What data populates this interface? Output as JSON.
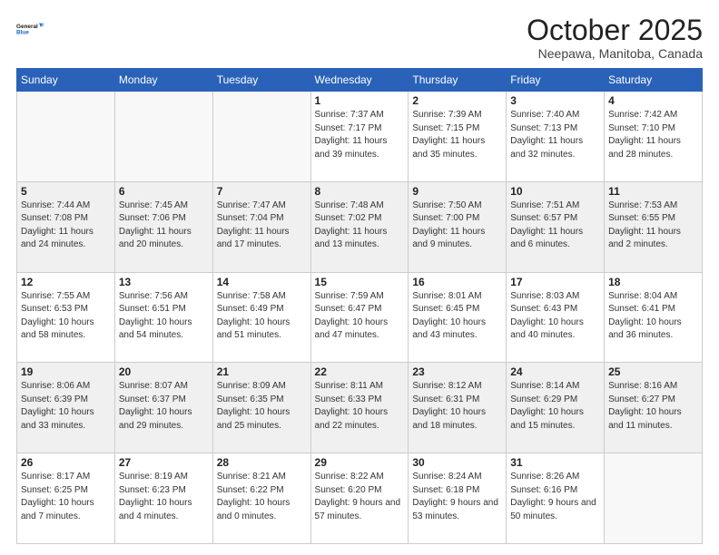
{
  "header": {
    "logo_line1": "General",
    "logo_line2": "Blue",
    "month": "October 2025",
    "location": "Neepawa, Manitoba, Canada"
  },
  "weekdays": [
    "Sunday",
    "Monday",
    "Tuesday",
    "Wednesday",
    "Thursday",
    "Friday",
    "Saturday"
  ],
  "rows": [
    [
      {
        "day": "",
        "empty": true
      },
      {
        "day": "",
        "empty": true
      },
      {
        "day": "",
        "empty": true
      },
      {
        "day": "1",
        "sunrise": "7:37 AM",
        "sunset": "7:17 PM",
        "daylight": "11 hours and 39 minutes."
      },
      {
        "day": "2",
        "sunrise": "7:39 AM",
        "sunset": "7:15 PM",
        "daylight": "11 hours and 35 minutes."
      },
      {
        "day": "3",
        "sunrise": "7:40 AM",
        "sunset": "7:13 PM",
        "daylight": "11 hours and 32 minutes."
      },
      {
        "day": "4",
        "sunrise": "7:42 AM",
        "sunset": "7:10 PM",
        "daylight": "11 hours and 28 minutes."
      }
    ],
    [
      {
        "day": "5",
        "sunrise": "7:44 AM",
        "sunset": "7:08 PM",
        "daylight": "11 hours and 24 minutes."
      },
      {
        "day": "6",
        "sunrise": "7:45 AM",
        "sunset": "7:06 PM",
        "daylight": "11 hours and 20 minutes."
      },
      {
        "day": "7",
        "sunrise": "7:47 AM",
        "sunset": "7:04 PM",
        "daylight": "11 hours and 17 minutes."
      },
      {
        "day": "8",
        "sunrise": "7:48 AM",
        "sunset": "7:02 PM",
        "daylight": "11 hours and 13 minutes."
      },
      {
        "day": "9",
        "sunrise": "7:50 AM",
        "sunset": "7:00 PM",
        "daylight": "11 hours and 9 minutes."
      },
      {
        "day": "10",
        "sunrise": "7:51 AM",
        "sunset": "6:57 PM",
        "daylight": "11 hours and 6 minutes."
      },
      {
        "day": "11",
        "sunrise": "7:53 AM",
        "sunset": "6:55 PM",
        "daylight": "11 hours and 2 minutes."
      }
    ],
    [
      {
        "day": "12",
        "sunrise": "7:55 AM",
        "sunset": "6:53 PM",
        "daylight": "10 hours and 58 minutes."
      },
      {
        "day": "13",
        "sunrise": "7:56 AM",
        "sunset": "6:51 PM",
        "daylight": "10 hours and 54 minutes."
      },
      {
        "day": "14",
        "sunrise": "7:58 AM",
        "sunset": "6:49 PM",
        "daylight": "10 hours and 51 minutes."
      },
      {
        "day": "15",
        "sunrise": "7:59 AM",
        "sunset": "6:47 PM",
        "daylight": "10 hours and 47 minutes."
      },
      {
        "day": "16",
        "sunrise": "8:01 AM",
        "sunset": "6:45 PM",
        "daylight": "10 hours and 43 minutes."
      },
      {
        "day": "17",
        "sunrise": "8:03 AM",
        "sunset": "6:43 PM",
        "daylight": "10 hours and 40 minutes."
      },
      {
        "day": "18",
        "sunrise": "8:04 AM",
        "sunset": "6:41 PM",
        "daylight": "10 hours and 36 minutes."
      }
    ],
    [
      {
        "day": "19",
        "sunrise": "8:06 AM",
        "sunset": "6:39 PM",
        "daylight": "10 hours and 33 minutes."
      },
      {
        "day": "20",
        "sunrise": "8:07 AM",
        "sunset": "6:37 PM",
        "daylight": "10 hours and 29 minutes."
      },
      {
        "day": "21",
        "sunrise": "8:09 AM",
        "sunset": "6:35 PM",
        "daylight": "10 hours and 25 minutes."
      },
      {
        "day": "22",
        "sunrise": "8:11 AM",
        "sunset": "6:33 PM",
        "daylight": "10 hours and 22 minutes."
      },
      {
        "day": "23",
        "sunrise": "8:12 AM",
        "sunset": "6:31 PM",
        "daylight": "10 hours and 18 minutes."
      },
      {
        "day": "24",
        "sunrise": "8:14 AM",
        "sunset": "6:29 PM",
        "daylight": "10 hours and 15 minutes."
      },
      {
        "day": "25",
        "sunrise": "8:16 AM",
        "sunset": "6:27 PM",
        "daylight": "10 hours and 11 minutes."
      }
    ],
    [
      {
        "day": "26",
        "sunrise": "8:17 AM",
        "sunset": "6:25 PM",
        "daylight": "10 hours and 7 minutes."
      },
      {
        "day": "27",
        "sunrise": "8:19 AM",
        "sunset": "6:23 PM",
        "daylight": "10 hours and 4 minutes."
      },
      {
        "day": "28",
        "sunrise": "8:21 AM",
        "sunset": "6:22 PM",
        "daylight": "10 hours and 0 minutes."
      },
      {
        "day": "29",
        "sunrise": "8:22 AM",
        "sunset": "6:20 PM",
        "daylight": "9 hours and 57 minutes."
      },
      {
        "day": "30",
        "sunrise": "8:24 AM",
        "sunset": "6:18 PM",
        "daylight": "9 hours and 53 minutes."
      },
      {
        "day": "31",
        "sunrise": "8:26 AM",
        "sunset": "6:16 PM",
        "daylight": "9 hours and 50 minutes."
      },
      {
        "day": "",
        "empty": true
      }
    ]
  ]
}
